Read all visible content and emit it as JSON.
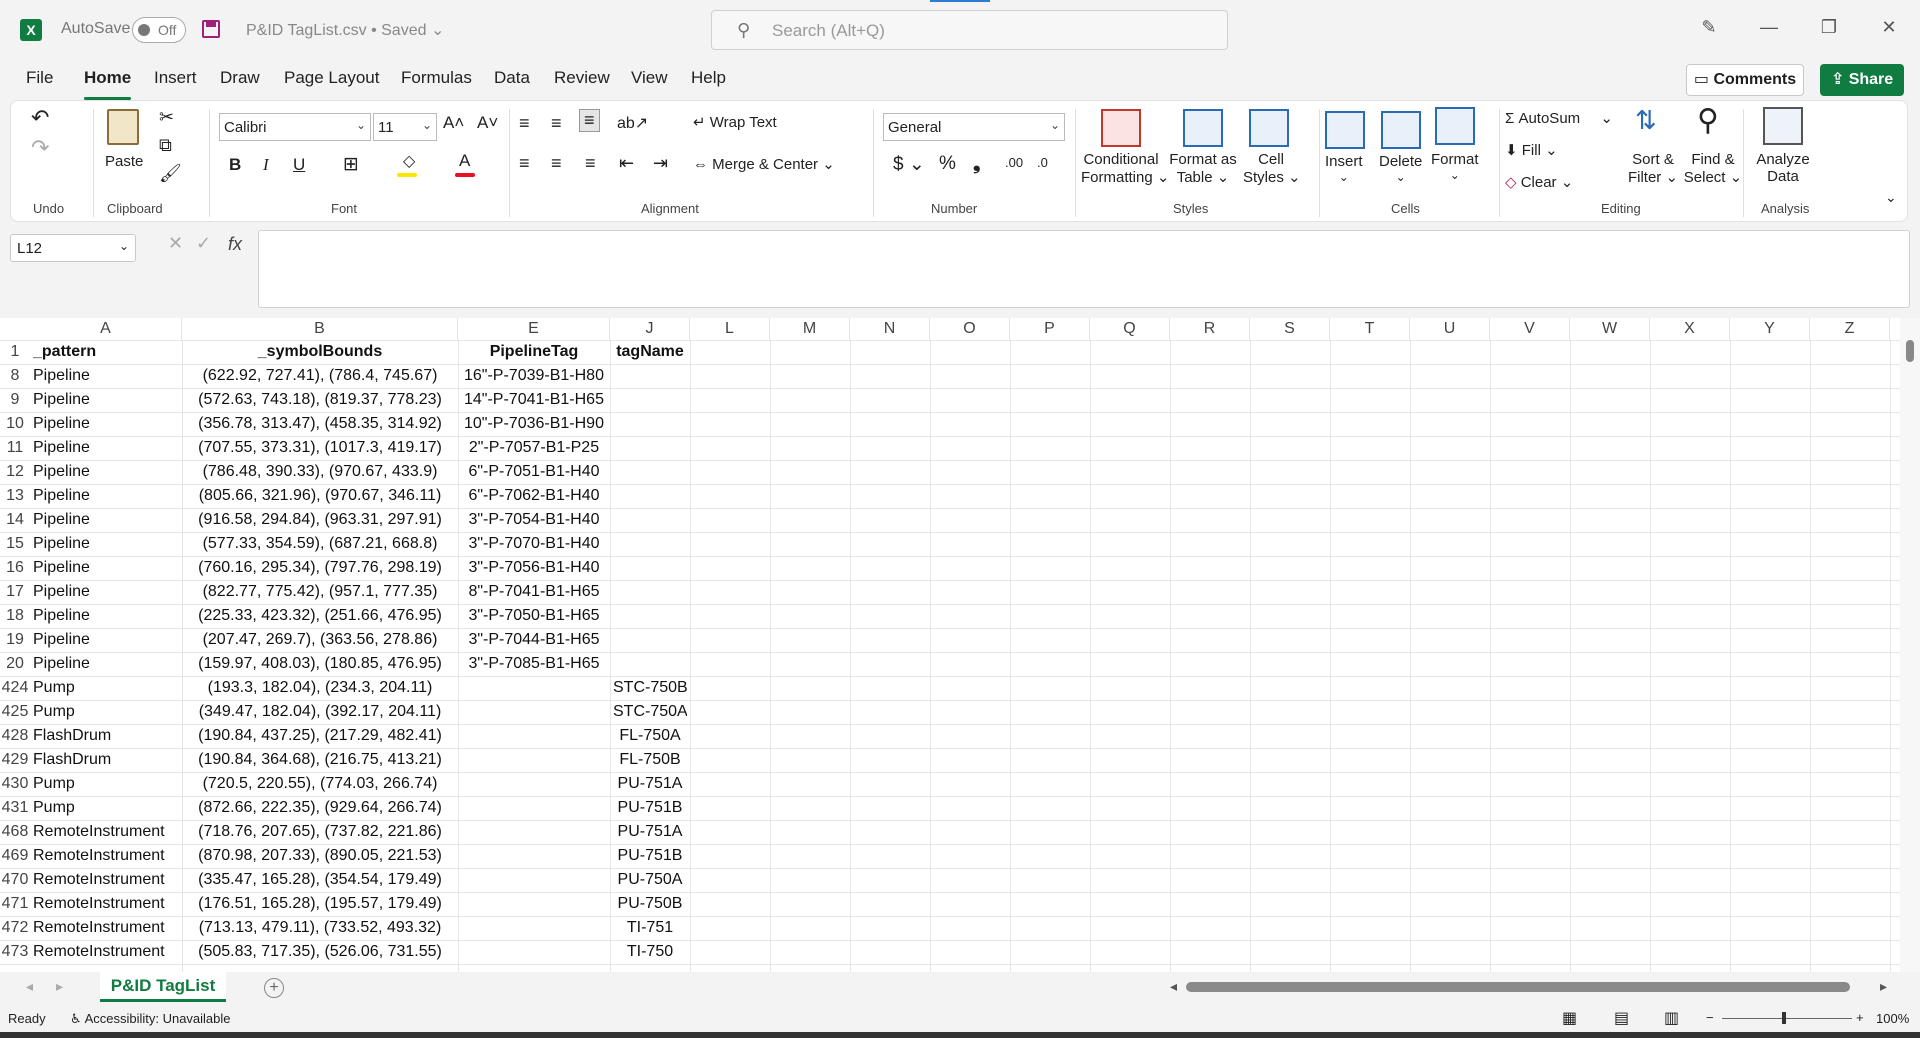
{
  "titlebar": {
    "autosave_label": "AutoSave",
    "autosave_state": "Off",
    "doc_title": "P&ID TagList.csv • Saved ⌄",
    "search_placeholder": "Search (Alt+Q)",
    "app_letter": "X"
  },
  "tabs": [
    "File",
    "Home",
    "Insert",
    "Draw",
    "Page Layout",
    "Formulas",
    "Data",
    "Review",
    "View",
    "Help"
  ],
  "actions": {
    "comments": "Comments",
    "share": "Share"
  },
  "ribbon": {
    "undo_group": "Undo",
    "clipboard_group": "Clipboard",
    "paste": "Paste",
    "font_group": "Font",
    "font_name": "Calibri",
    "font_size": "11",
    "alignment_group": "Alignment",
    "wrap_text": "Wrap Text",
    "merge_center": "Merge & Center",
    "number_group": "Number",
    "number_format": "General",
    "styles_group": "Styles",
    "conditional_formatting": [
      "Conditional",
      "Formatting ⌄"
    ],
    "format_as_table": [
      "Format as",
      "Table ⌄"
    ],
    "cell_styles": [
      "Cell",
      "Styles ⌄"
    ],
    "cells_group": "Cells",
    "insert": "Insert",
    "delete": "Delete",
    "format": "Format",
    "editing_group": "Editing",
    "autosum": "AutoSum",
    "fill": "Fill ⌄",
    "clear": "Clear ⌄",
    "sort_filter": [
      "Sort &",
      "Filter ⌄"
    ],
    "find_select": [
      "Find &",
      "Select ⌄"
    ],
    "analysis_group": "Analysis",
    "analyze_data": [
      "Analyze",
      "Data"
    ]
  },
  "formula_bar": {
    "name_box": "L12",
    "fx": "fx",
    "formula": ""
  },
  "sheet": {
    "columns": [
      "A",
      "B",
      "E",
      "J",
      "L",
      "M",
      "N",
      "O",
      "P",
      "Q",
      "R",
      "S",
      "T",
      "U",
      "V",
      "W",
      "X",
      "Y",
      "Z"
    ],
    "rows": [
      {
        "n": "1",
        "a": "_pattern",
        "b": "_symbolBounds",
        "e": "PipelineTag",
        "j": "tagName"
      },
      {
        "n": "8",
        "a": "Pipeline",
        "b": "(622.92, 727.41), (786.4, 745.67)",
        "e": "16\"-P-7039-B1-H80",
        "j": ""
      },
      {
        "n": "9",
        "a": "Pipeline",
        "b": "(572.63, 743.18), (819.37, 778.23)",
        "e": "14\"-P-7041-B1-H65",
        "j": ""
      },
      {
        "n": "10",
        "a": "Pipeline",
        "b": "(356.78, 313.47), (458.35, 314.92)",
        "e": "10\"-P-7036-B1-H90",
        "j": ""
      },
      {
        "n": "11",
        "a": "Pipeline",
        "b": "(707.55, 373.31), (1017.3, 419.17)",
        "e": "2\"-P-7057-B1-P25",
        "j": ""
      },
      {
        "n": "12",
        "a": "Pipeline",
        "b": "(786.48, 390.33), (970.67, 433.9)",
        "e": "6\"-P-7051-B1-H40",
        "j": ""
      },
      {
        "n": "13",
        "a": "Pipeline",
        "b": "(805.66, 321.96), (970.67, 346.11)",
        "e": "6\"-P-7062-B1-H40",
        "j": ""
      },
      {
        "n": "14",
        "a": "Pipeline",
        "b": "(916.58, 294.84), (963.31, 297.91)",
        "e": "3\"-P-7054-B1-H40",
        "j": ""
      },
      {
        "n": "15",
        "a": "Pipeline",
        "b": "(577.33, 354.59), (687.21, 668.8)",
        "e": "3\"-P-7070-B1-H40",
        "j": ""
      },
      {
        "n": "16",
        "a": "Pipeline",
        "b": "(760.16, 295.34), (797.76, 298.19)",
        "e": "3\"-P-7056-B1-H40",
        "j": ""
      },
      {
        "n": "17",
        "a": "Pipeline",
        "b": "(822.77, 775.42), (957.1, 777.35)",
        "e": "8\"-P-7041-B1-H65",
        "j": ""
      },
      {
        "n": "18",
        "a": "Pipeline",
        "b": "(225.33, 423.32), (251.66, 476.95)",
        "e": "3\"-P-7050-B1-H65",
        "j": ""
      },
      {
        "n": "19",
        "a": "Pipeline",
        "b": "(207.47, 269.7), (363.56, 278.86)",
        "e": "3\"-P-7044-B1-H65",
        "j": ""
      },
      {
        "n": "20",
        "a": "Pipeline",
        "b": "(159.97, 408.03), (180.85, 476.95)",
        "e": "3\"-P-7085-B1-H65",
        "j": ""
      },
      {
        "n": "424",
        "a": "Pump",
        "b": "(193.3, 182.04), (234.3, 204.11)",
        "e": "",
        "j": "STC-750B"
      },
      {
        "n": "425",
        "a": "Pump",
        "b": "(349.47, 182.04), (392.17, 204.11)",
        "e": "",
        "j": "STC-750A"
      },
      {
        "n": "428",
        "a": "FlashDrum",
        "b": "(190.84, 437.25), (217.29, 482.41)",
        "e": "",
        "j": "FL-750A"
      },
      {
        "n": "429",
        "a": "FlashDrum",
        "b": "(190.84, 364.68), (216.75, 413.21)",
        "e": "",
        "j": "FL-750B"
      },
      {
        "n": "430",
        "a": "Pump",
        "b": "(720.5, 220.55), (774.03, 266.74)",
        "e": "",
        "j": "PU-751A"
      },
      {
        "n": "431",
        "a": "Pump",
        "b": "(872.66, 222.35), (929.64, 266.74)",
        "e": "",
        "j": "PU-751B"
      },
      {
        "n": "468",
        "a": "RemoteInstrument",
        "b": "(718.76, 207.65), (737.82, 221.86)",
        "e": "",
        "j": "PU-751A"
      },
      {
        "n": "469",
        "a": "RemoteInstrument",
        "b": "(870.98, 207.33), (890.05, 221.53)",
        "e": "",
        "j": "PU-751B"
      },
      {
        "n": "470",
        "a": "RemoteInstrument",
        "b": "(335.47, 165.28), (354.54, 179.49)",
        "e": "",
        "j": "PU-750A"
      },
      {
        "n": "471",
        "a": "RemoteInstrument",
        "b": "(176.51, 165.28), (195.57, 179.49)",
        "e": "",
        "j": "PU-750B"
      },
      {
        "n": "472",
        "a": "RemoteInstrument",
        "b": "(713.13, 479.11), (733.52, 493.32)",
        "e": "",
        "j": "TI-751"
      },
      {
        "n": "473",
        "a": "RemoteInstrument",
        "b": "(505.83, 717.35), (526.06, 731.55)",
        "e": "",
        "j": "TI-750"
      }
    ]
  },
  "sheet_tab": "P&ID TagList",
  "status": {
    "ready": "Ready",
    "accessibility": "Accessibility: Unavailable",
    "zoom": "100%"
  },
  "colors": {
    "accent": "#107c41",
    "share_bg": "#107c41",
    "tab_underline": "#107c41"
  }
}
